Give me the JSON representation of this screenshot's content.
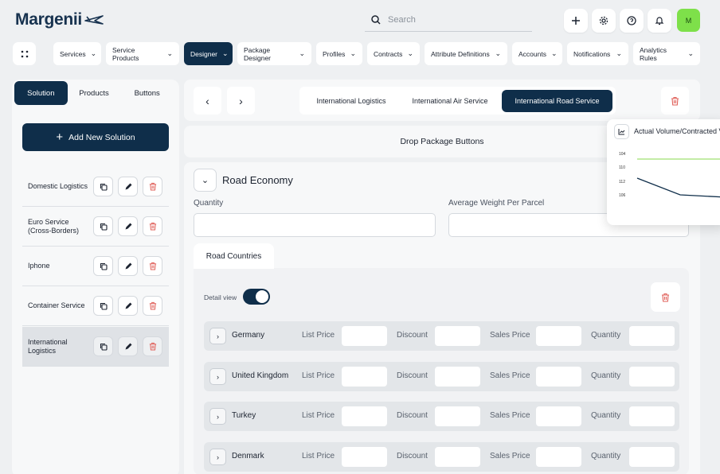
{
  "header": {
    "logo": "Margenii",
    "search_placeholder": "Search",
    "avatar_initial": "M"
  },
  "nav": {
    "items": [
      {
        "label": "Services"
      },
      {
        "label": "Service Products"
      },
      {
        "label": "Designer",
        "active": true
      },
      {
        "label": "Package Designer"
      },
      {
        "label": "Profiles"
      },
      {
        "label": "Contracts"
      },
      {
        "label": "Attribute Definitions"
      },
      {
        "label": "Accounts"
      },
      {
        "label": "Notifications"
      },
      {
        "label": "Analytics Rules"
      }
    ]
  },
  "left": {
    "segments": [
      "Solution",
      "Products",
      "Buttons"
    ],
    "add_label": "Add New Solution",
    "solutions": [
      {
        "name": "Domestic Logistics"
      },
      {
        "name": "Euro Service (Cross-Borders)"
      },
      {
        "name": "Iphone"
      },
      {
        "name": "Container Service"
      },
      {
        "name": "International Logistics"
      }
    ]
  },
  "main": {
    "tabs": [
      "International Logistics",
      "International Air Service",
      "International Road Service"
    ],
    "drop_label": "Drop Package Buttons",
    "section_title": "Road Economy",
    "quantity_label": "Quantity",
    "avg_weight_label": "Average Weight Per Parcel",
    "sub_tab": "Road Countries",
    "detail_view_label": "Detail view",
    "field_labels": {
      "list_price": "List Price",
      "discount": "Discount",
      "sales_price": "Sales Price",
      "quantity": "Quantity"
    },
    "countries": [
      "Germany",
      "United Kingdom",
      "Turkey",
      "Denmark"
    ]
  },
  "popup": {
    "title": "Actual Volume/Contracted V",
    "ticks": [
      "104",
      "110",
      "112",
      "106"
    ]
  },
  "colors": {
    "navy": "#0f2e4a",
    "accent_green": "#7ee04a",
    "delete_red": "#e0605a"
  }
}
